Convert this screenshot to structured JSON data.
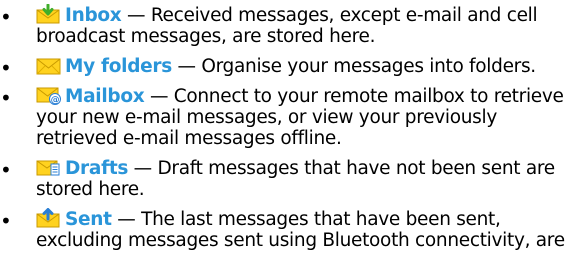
{
  "items": [
    {
      "icon": "inbox-envelope-icon",
      "name": "Inbox",
      "separator": " — ",
      "description": "Received messages, except e-mail and cell broadcast messages, are stored here."
    },
    {
      "icon": "folder-envelope-icon",
      "name": "My folders",
      "separator": " — ",
      "description": "Organise your messages into folders."
    },
    {
      "icon": "mailbox-envelope-icon",
      "name": "Mailbox",
      "separator": " — ",
      "description": "Connect to your remote mailbox to retrieve your new e-mail messages, or view your previously retrieved e-mail messages offline."
    },
    {
      "icon": "drafts-envelope-icon",
      "name": "Drafts",
      "separator": " — ",
      "description": "Draft messages that have not been sent are stored here."
    },
    {
      "icon": "sent-envelope-icon",
      "name": "Sent",
      "separator": " — ",
      "description": "The last messages that have been sent, excluding messages sent using Bluetooth connectivity, are"
    }
  ],
  "bullet_char": "•",
  "colors": {
    "link": "#2a95d9",
    "envelope": "#ffd21f",
    "arrow_green": "#3fae2a",
    "at_blue": "#2a7fd4"
  }
}
